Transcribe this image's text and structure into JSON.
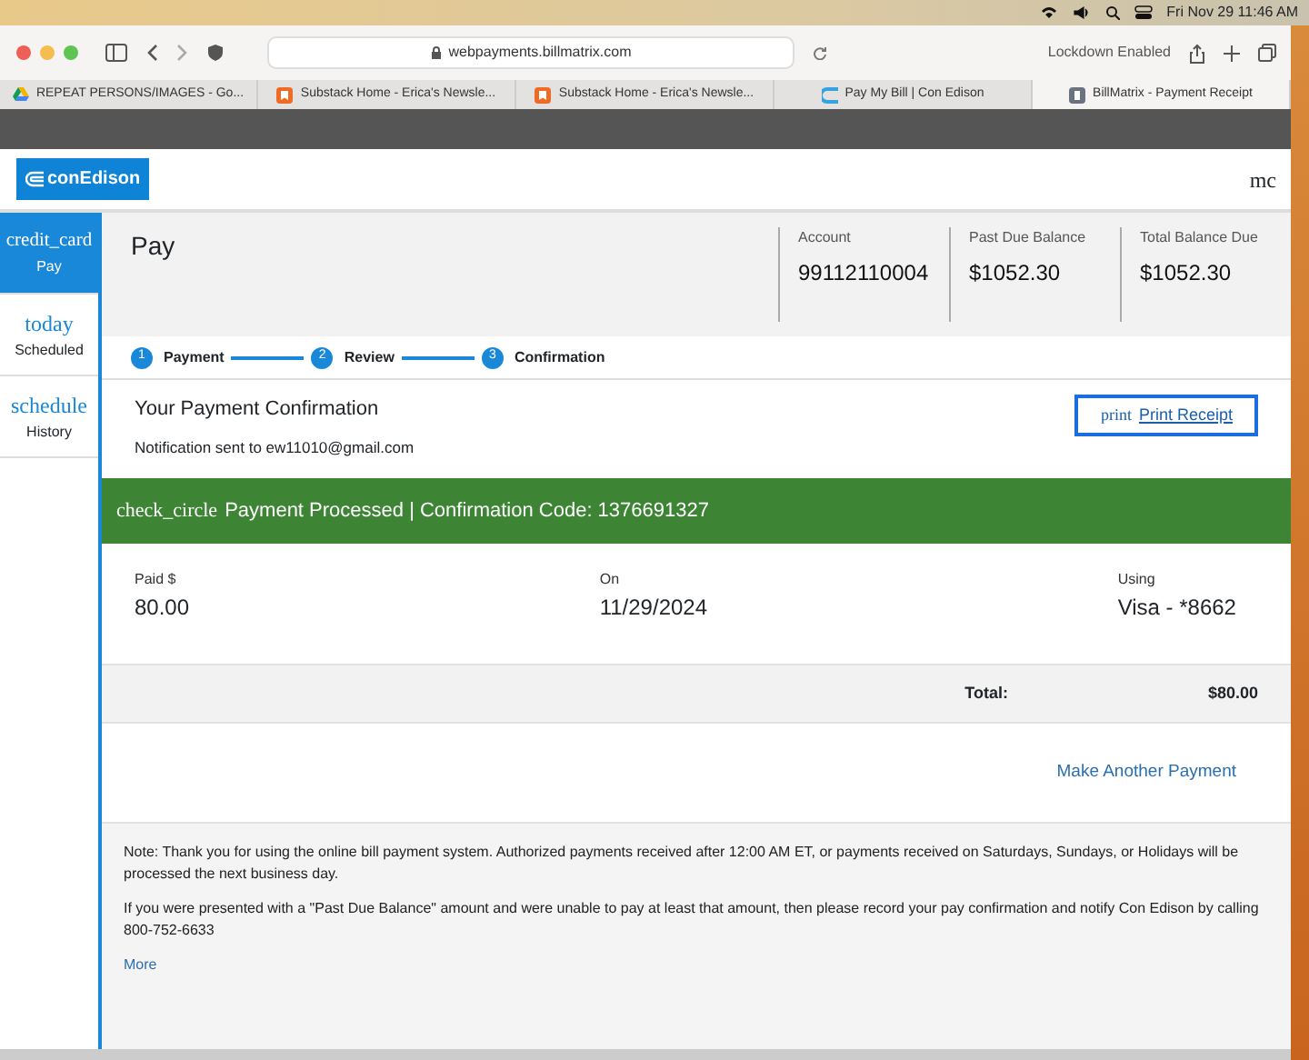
{
  "menubar": {
    "date_time": "Fri Nov 29  11:46 AM"
  },
  "browser": {
    "url": "webpayments.billmatrix.com",
    "lockdown": "Lockdown Enabled",
    "tabs": [
      {
        "title": "REPEAT PERSONS/IMAGES - Go...",
        "selected": false
      },
      {
        "title": "Substack Home - Erica's Newsle...",
        "selected": false
      },
      {
        "title": "Substack Home - Erica's Newsle...",
        "selected": false
      },
      {
        "title": "Pay My Bill | Con Edison",
        "selected": false
      },
      {
        "title": "BillMatrix - Payment Receipt",
        "selected": true
      }
    ]
  },
  "page": {
    "logo": "conEdison",
    "header_cut": "mc",
    "sidebar": [
      {
        "icon_text": "credit_card",
        "label": "Pay",
        "selected": true
      },
      {
        "icon_text": "today",
        "label": "Scheduled",
        "selected": false
      },
      {
        "icon_text": "schedule",
        "label": "History",
        "selected": false
      }
    ],
    "title": "Pay",
    "summary": [
      {
        "label": "Account",
        "value": "99112110004"
      },
      {
        "label": "Past Due Balance",
        "value": "$1052.30"
      },
      {
        "label": "Total Balance Due",
        "value": "$1052.30"
      }
    ],
    "steps": [
      {
        "number": "1",
        "label": "Payment"
      },
      {
        "number": "2",
        "label": "Review"
      },
      {
        "number": "3",
        "label": "Confirmation"
      }
    ],
    "confirmation": {
      "title": "Your Payment Confirmation",
      "notification": "Notification sent to ew11010@gmail.com",
      "print_icon_text": "print",
      "print_label": "Print Receipt"
    },
    "banner": {
      "icon_text": "check_circle",
      "text": "Payment Processed | Confirmation Code: 1376691327"
    },
    "details": [
      {
        "label": "Paid $",
        "value": "80.00"
      },
      {
        "label": "On",
        "value": "11/29/2024"
      },
      {
        "label": "Using",
        "value": "Visa - *8662"
      }
    ],
    "total": {
      "label": "Total:",
      "value": "$80.00"
    },
    "make_another": "Make Another Payment",
    "notes": [
      "Note: Thank you for using the online bill payment system. Authorized payments received after 12:00 AM ET, or payments received on Saturdays, Sundays, or Holidays will be processed the next business day.",
      "If you were presented with a \"Past Due Balance\" amount and were unable to pay at least that amount, then please record your pay confirmation and notify Con Edison by calling 800-752-6633"
    ],
    "more": "More"
  }
}
